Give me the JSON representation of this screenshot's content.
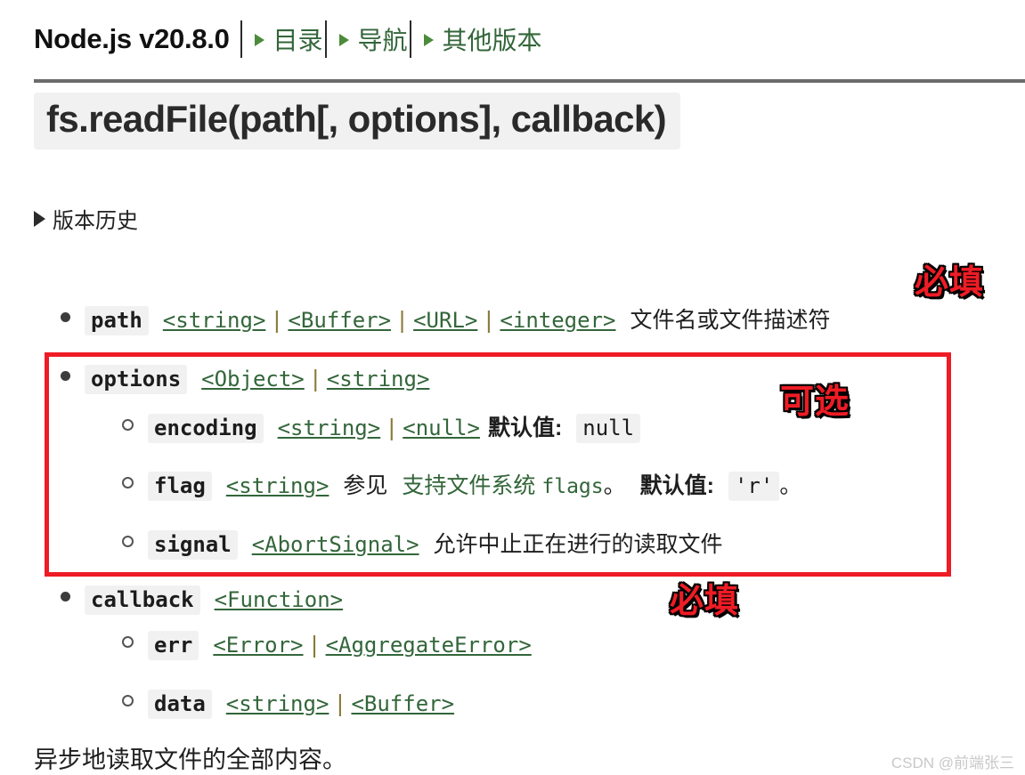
{
  "header": {
    "brand": "Node.js v20.8.0",
    "nav": [
      {
        "label": "目录",
        "icon": "triangle-right-icon"
      },
      {
        "label": "导航",
        "icon": "triangle-right-icon"
      },
      {
        "label": "其他版本",
        "icon": "triangle-right-icon"
      }
    ]
  },
  "page": {
    "title": "fs.readFile(path[, options], callback)",
    "version_history_label": "版本历史",
    "version_history_icon": "triangle-right-collapsed-icon",
    "summary": "异步地读取文件的全部内容。",
    "watermark": "CSDN @前端张三"
  },
  "params": {
    "path": {
      "name": "path",
      "types": [
        "<string>",
        "<Buffer>",
        "<URL>",
        "<integer>"
      ],
      "description": "文件名或文件描述符"
    },
    "options": {
      "name": "options",
      "types": [
        "<Object>",
        "<string>"
      ],
      "children": {
        "encoding": {
          "name": "encoding",
          "types": [
            "<string>",
            "<null>"
          ],
          "default_label": "默认值:",
          "default_value": "null"
        },
        "flag": {
          "name": "flag",
          "types": [
            "<string>"
          ],
          "see_label": "参见",
          "see_link_text": "支持文件系统",
          "see_link_code": "flags",
          "period": "。",
          "default_label": "默认值:",
          "default_value": "'r'",
          "trailing_period": "。"
        },
        "signal": {
          "name": "signal",
          "types": [
            "<AbortSignal>"
          ],
          "description": "允许中止正在进行的读取文件"
        }
      }
    },
    "callback": {
      "name": "callback",
      "types": [
        "<Function>"
      ],
      "children": {
        "err": {
          "name": "err",
          "types": [
            "<Error>",
            "<AggregateError>"
          ]
        },
        "data": {
          "name": "data",
          "types": [
            "<string>",
            "<Buffer>"
          ]
        }
      }
    }
  },
  "annotations": {
    "required_top": "必填",
    "optional": "可选",
    "required_bottom": "必填",
    "color": "#ee1c25",
    "box_color": "#ee1c25"
  },
  "colors": {
    "link_green": "#33663a",
    "code_bg": "#f1f1f1",
    "rule": "#6b6b6b",
    "watermark": "#c8c8c8"
  },
  "separators": {
    "pipe": "|"
  }
}
